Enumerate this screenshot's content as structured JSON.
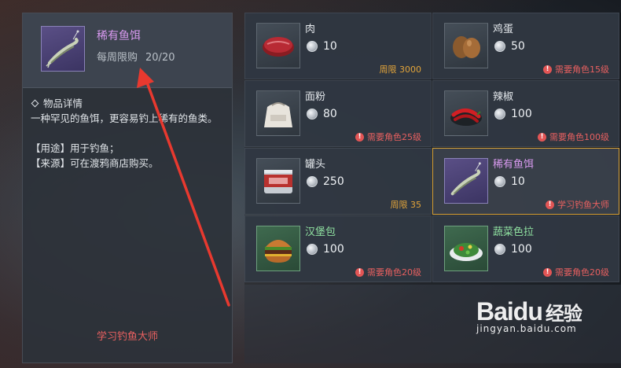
{
  "detail": {
    "name": "稀有鱼饵",
    "limit_label": "每周限购",
    "limit_value": "20/20",
    "section_title": "物品详情",
    "description": "一种罕见的鱼饵，更容易钓上稀有的鱼类。",
    "usage": "【用途】用于钓鱼；",
    "source": "【来源】可在渡鸦商店购买。",
    "footer": "学习钓鱼大师"
  },
  "items": [
    {
      "name": "肉",
      "price": "10",
      "note": "周限 3000",
      "note_type": "limit",
      "icon": "meat-icon"
    },
    {
      "name": "鸡蛋",
      "price": "50",
      "note": "需要角色15级",
      "note_type": "warning",
      "icon": "eggs-icon"
    },
    {
      "name": "面粉",
      "price": "80",
      "note": "需要角色25级",
      "note_type": "warning",
      "icon": "flour-sack-icon"
    },
    {
      "name": "辣椒",
      "price": "100",
      "note": "需要角色100级",
      "note_type": "warning",
      "icon": "chili-pepper-icon"
    },
    {
      "name": "罐头",
      "price": "250",
      "note": "周限 35",
      "note_type": "limit",
      "icon": "canned-food-icon"
    },
    {
      "name": "稀有鱼饵",
      "price": "10",
      "note": "学习钓鱼大师",
      "note_type": "warning",
      "icon": "shrimp-bait-icon",
      "rarity": "purple",
      "selected": true
    },
    {
      "name": "汉堡包",
      "price": "100",
      "note": "需要角色20级",
      "note_type": "warning",
      "icon": "burger-icon",
      "rarity": "green"
    },
    {
      "name": "蔬菜色拉",
      "price": "100",
      "note": "需要角色20级",
      "note_type": "warning",
      "icon": "salad-icon",
      "rarity": "green"
    }
  ],
  "watermark": {
    "logo_text": "Bai",
    "logo_du": "du",
    "logo_suffix": "经验",
    "url": "jingyan.baidu.com"
  },
  "colors": {
    "rare_purple": "#d99af0",
    "uncommon_green": "#8fe0a0",
    "warning_red": "#e86060",
    "limit_gold": "#e2a43a",
    "selected_border": "#d9a33a",
    "arrow_red": "#e8392f"
  }
}
